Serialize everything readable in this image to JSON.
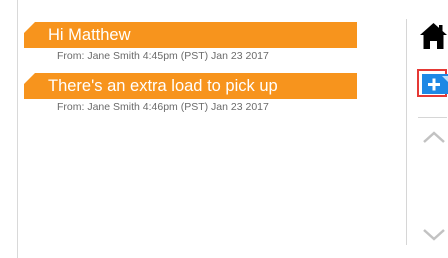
{
  "messages": [
    {
      "text": "Hi Matthew",
      "meta": "From: Jane Smith  4:45pm (PST) Jan 23 2017"
    },
    {
      "text": "There's an extra load to pick up",
      "meta": "From: Jane Smith  4:46pm (PST) Jan 23 2017"
    }
  ],
  "sidebar": {
    "icons": [
      "home-icon",
      "add-message-icon",
      "chevron-up-icon",
      "chevron-down-icon"
    ],
    "highlight_color": "#e53935",
    "add_icon_color": "#1e88e5"
  },
  "colors": {
    "bubble": "#f7941d",
    "bubble_text": "#ffffff",
    "meta_text": "#6b6b6b"
  }
}
